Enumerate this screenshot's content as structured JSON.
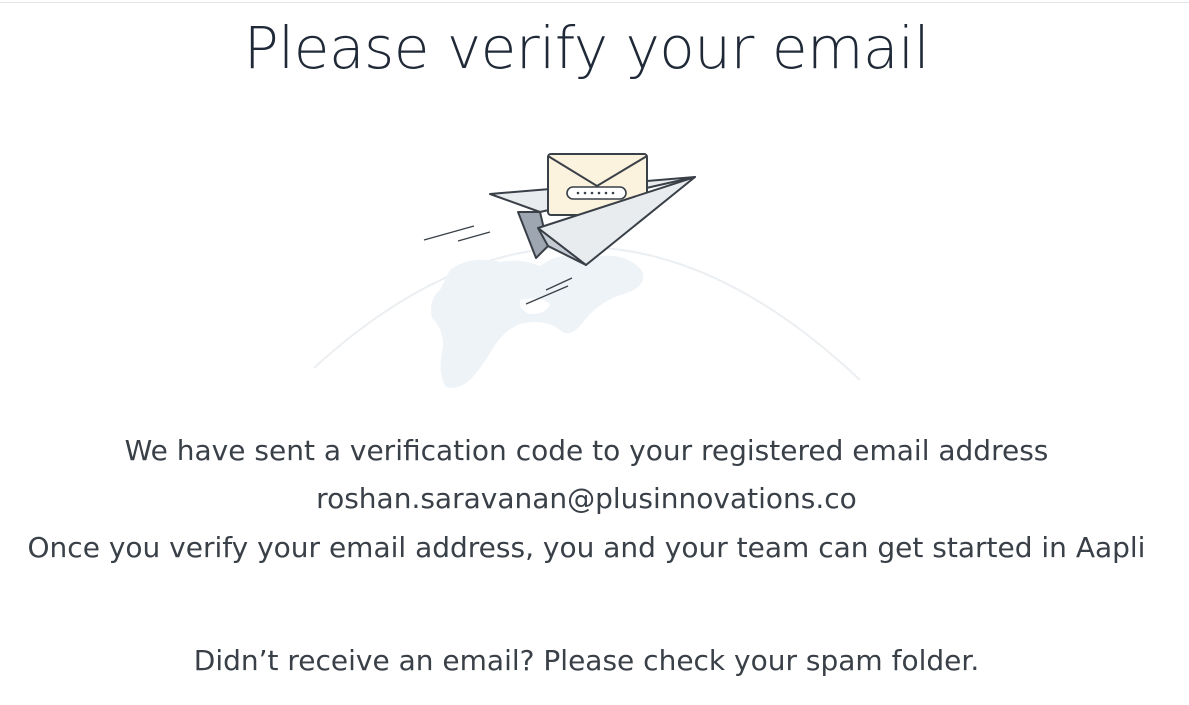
{
  "page": {
    "title": "Please verify your email"
  },
  "illustration": {
    "icon": "paper-plane-envelope-icon"
  },
  "message": {
    "line1": "We have sent a verification code to your registered email address",
    "email": "roshan.saravanan@plusinnovations.co",
    "line3": "Once you verify your email address, you and your team can get started in Aapli",
    "spam_note": "Didn’t receive an email? Please check your spam folder."
  },
  "colors": {
    "title": "#1f2937",
    "text": "#3a4048",
    "envelope": "#fbf3de",
    "plane_light": "#e9ecef",
    "plane_dark": "#9ea6b2",
    "globe": "#eef3f8"
  }
}
